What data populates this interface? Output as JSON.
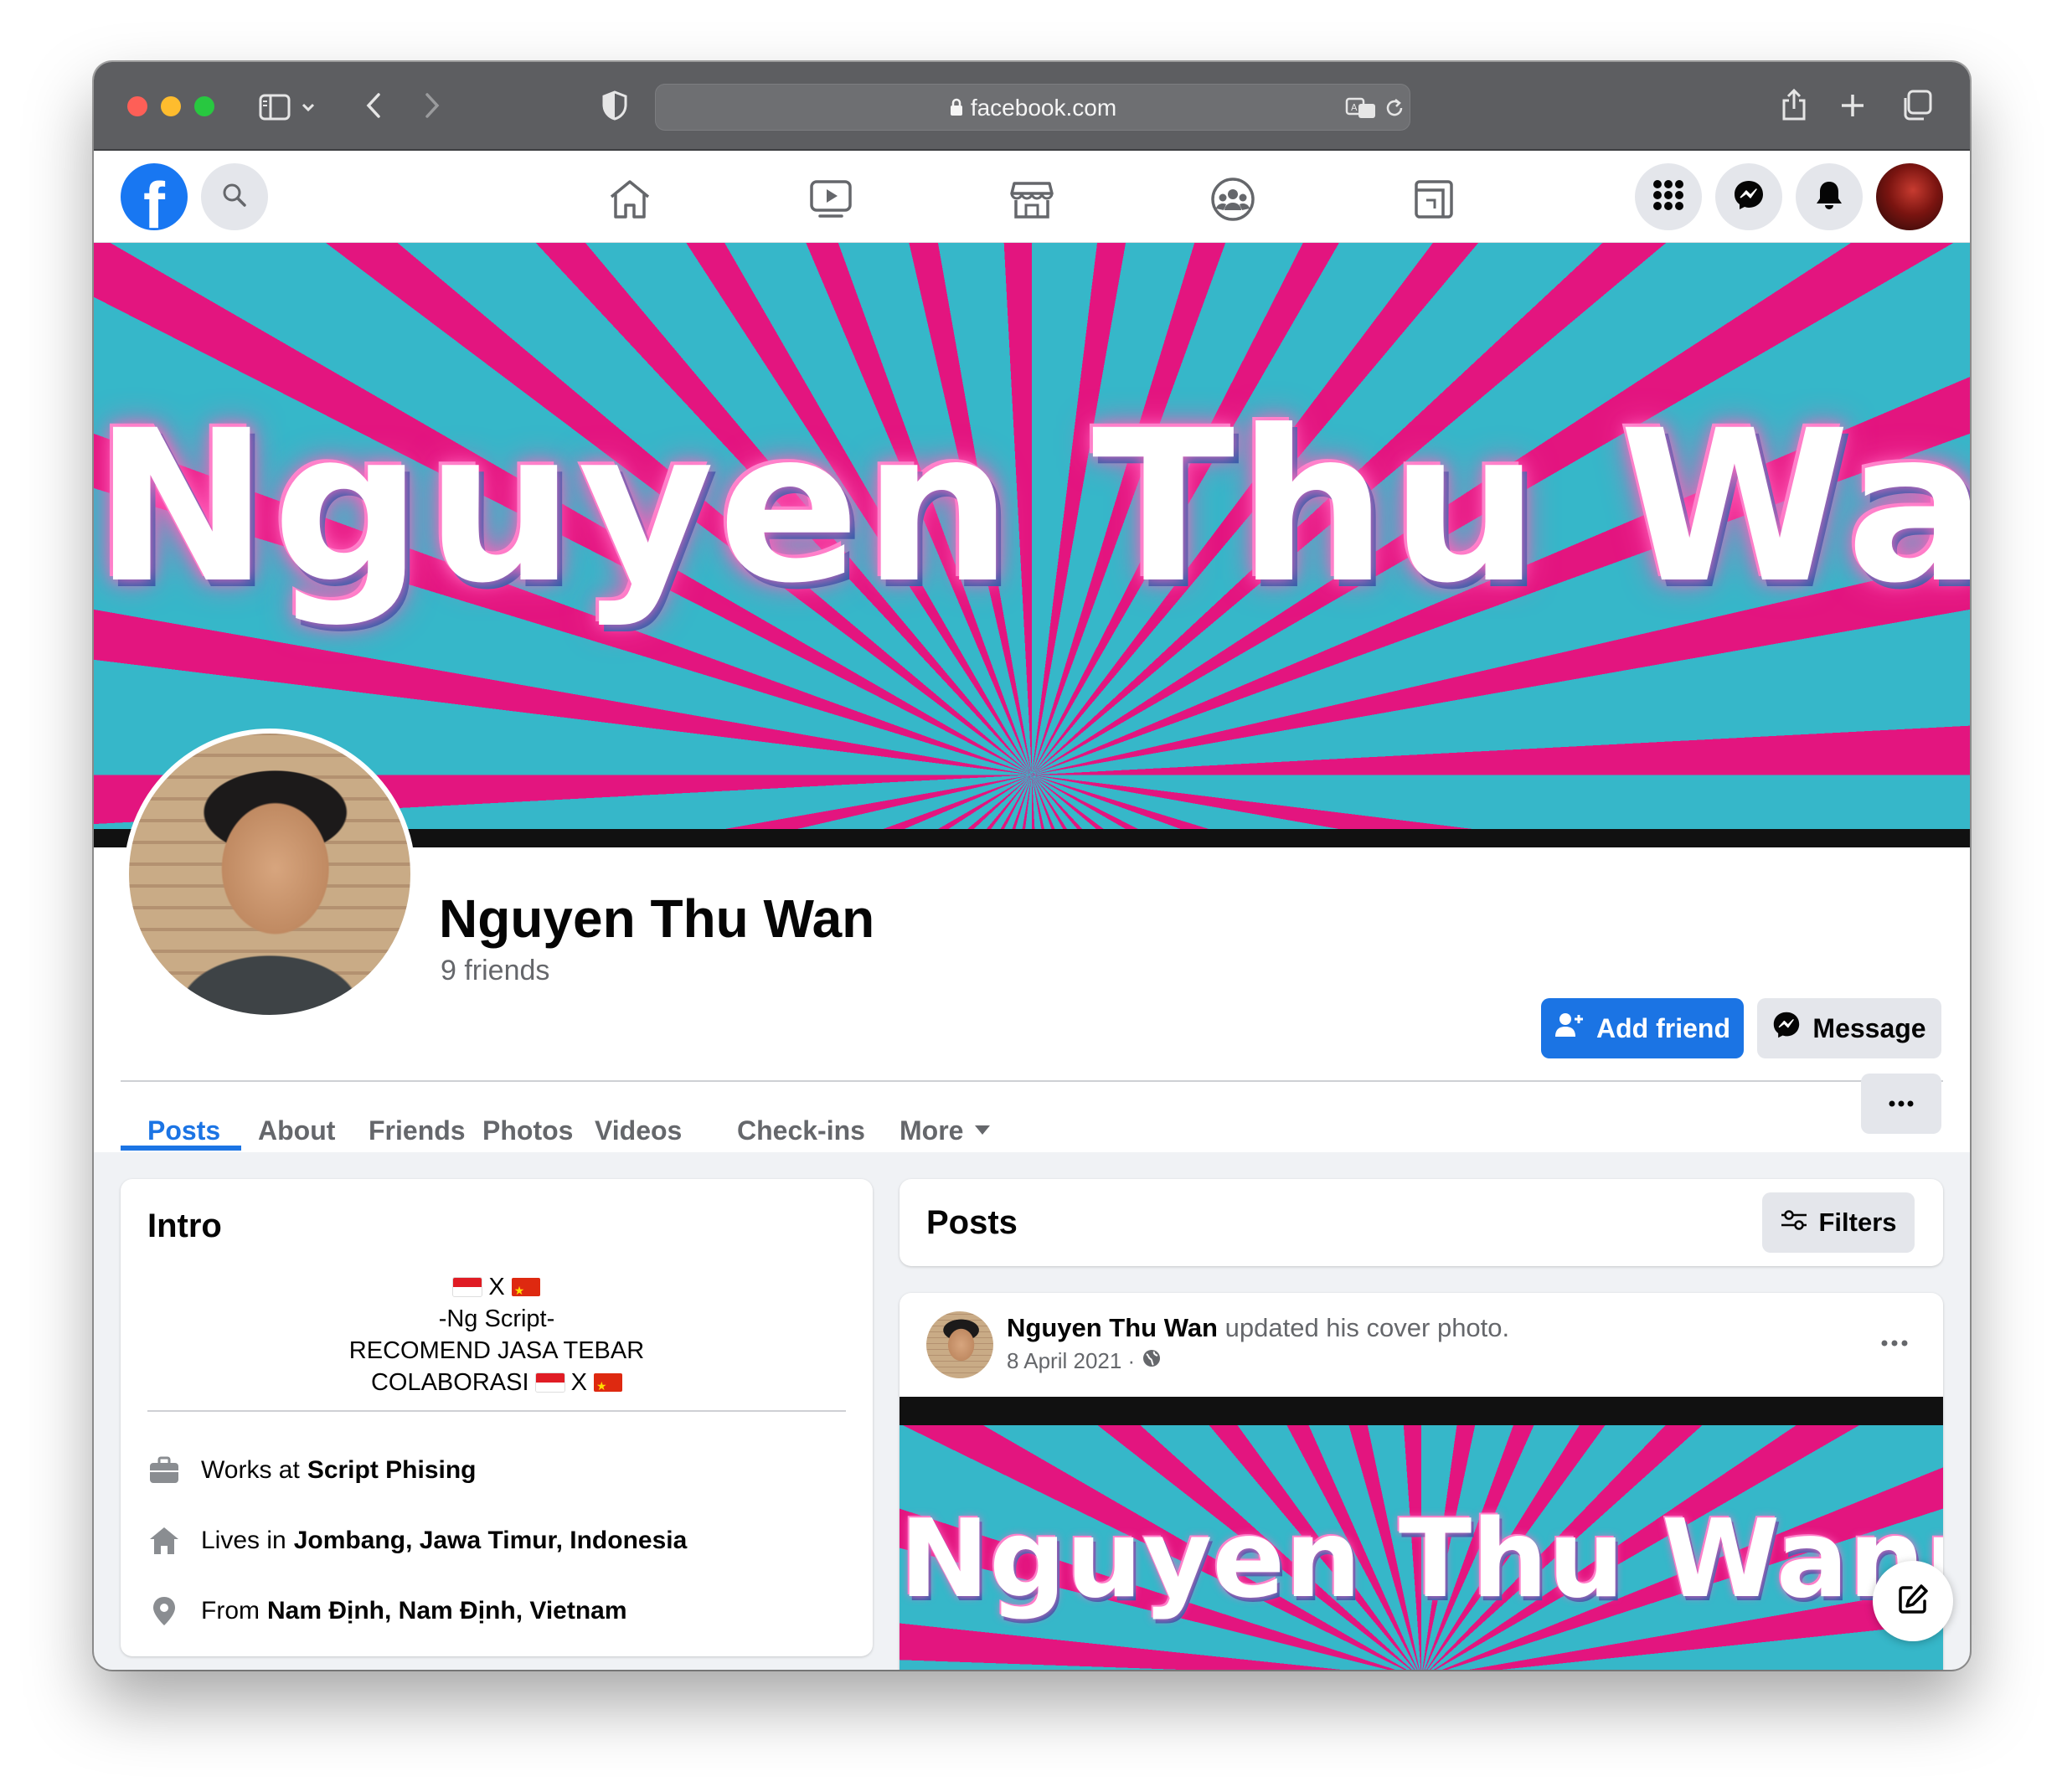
{
  "browser": {
    "url": "facebook.com",
    "icons": [
      "sidebar-icon",
      "chevron-down-icon",
      "back-icon",
      "forward-icon",
      "shield-icon",
      "lock-icon",
      "translate-icon",
      "reload-icon",
      "share-icon",
      "new-tab-icon",
      "tabs-overview-icon"
    ]
  },
  "nav": {
    "logo": "f",
    "center_icons": [
      "home-icon",
      "watch-icon",
      "marketplace-icon",
      "groups-icon",
      "gaming-icon"
    ],
    "right_icons": [
      "menu-grid-icon",
      "messenger-icon",
      "notifications-icon",
      "account-avatar"
    ]
  },
  "cover": {
    "text": "Nguyen Thu Wann",
    "colors": {
      "pink": "#e3157f",
      "cyan": "#36b7c9"
    }
  },
  "profile": {
    "name": "Nguyen Thu Wan",
    "friends": "9 friends",
    "add_friend_label": "Add friend",
    "message_label": "Message"
  },
  "tabs": {
    "items": [
      "Posts",
      "About",
      "Friends",
      "Photos",
      "Videos",
      "Check-ins",
      "More"
    ],
    "active": "Posts"
  },
  "intro": {
    "title": "Intro",
    "bio_line1_sep": "X",
    "bio_line2": "-Ng Script-",
    "bio_line3": "RECOMEND JASA TEBAR",
    "bio_line4": "COLABORASI",
    "bio_line4_sep": "X",
    "work_prefix": "Works at",
    "work_value": "Script Phising",
    "lives_prefix": "Lives in",
    "lives_value": "Jombang, Jawa Timur, Indonesia",
    "from_prefix": "From",
    "from_value": "Nam Định, Nam Định, Vietnam"
  },
  "posts": {
    "title": "Posts",
    "filters_label": "Filters",
    "post": {
      "author": "Nguyen Thu Wan",
      "action": "updated his cover photo.",
      "date": "8 April 2021 ·",
      "image_text": "Nguyen Thu Wann"
    }
  },
  "colors": {
    "brand_blue": "#1877f2",
    "button_blue": "#1b74e4",
    "secondary_bg": "#e4e6eb",
    "page_bg": "#f0f2f5"
  }
}
